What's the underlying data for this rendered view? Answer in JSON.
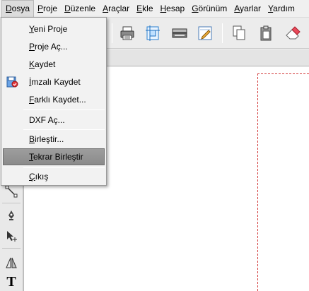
{
  "menubar": {
    "items": [
      "Dosya",
      "Proje",
      "Düzenle",
      "Araçlar",
      "Ekle",
      "Hesap",
      "Görünüm",
      "Ayarlar",
      "Yardım"
    ]
  },
  "file_menu": {
    "items": [
      {
        "label": "Yeni Proje"
      },
      {
        "label": "Proje Aç..."
      },
      {
        "label": "Kaydet"
      },
      {
        "label": "İmzalı Kaydet",
        "icon": "signed-save-icon"
      },
      {
        "label": "Farklı Kaydet..."
      },
      {
        "label": "DXF Aç..."
      },
      {
        "label": "Birleştir..."
      },
      {
        "label": "Tekrar Birleştir",
        "highlighted": true
      },
      {
        "label": "Çıkış"
      }
    ]
  },
  "toolbar": {
    "icons": [
      "print-icon",
      "page-setup-icon",
      "scanner-icon",
      "edit-icon",
      "copy-icon",
      "paste-icon",
      "eraser-icon"
    ]
  },
  "left_toolbar": {
    "icons": [
      "line-tool-icon",
      "pen-tool-icon",
      "move-tool-icon",
      "mirror-tool-icon",
      "text-tool-icon"
    ],
    "text_tool_glyph": "T"
  },
  "colors": {
    "page_border_dash": "#d23a3a",
    "highlight": "#8f8f8f"
  }
}
